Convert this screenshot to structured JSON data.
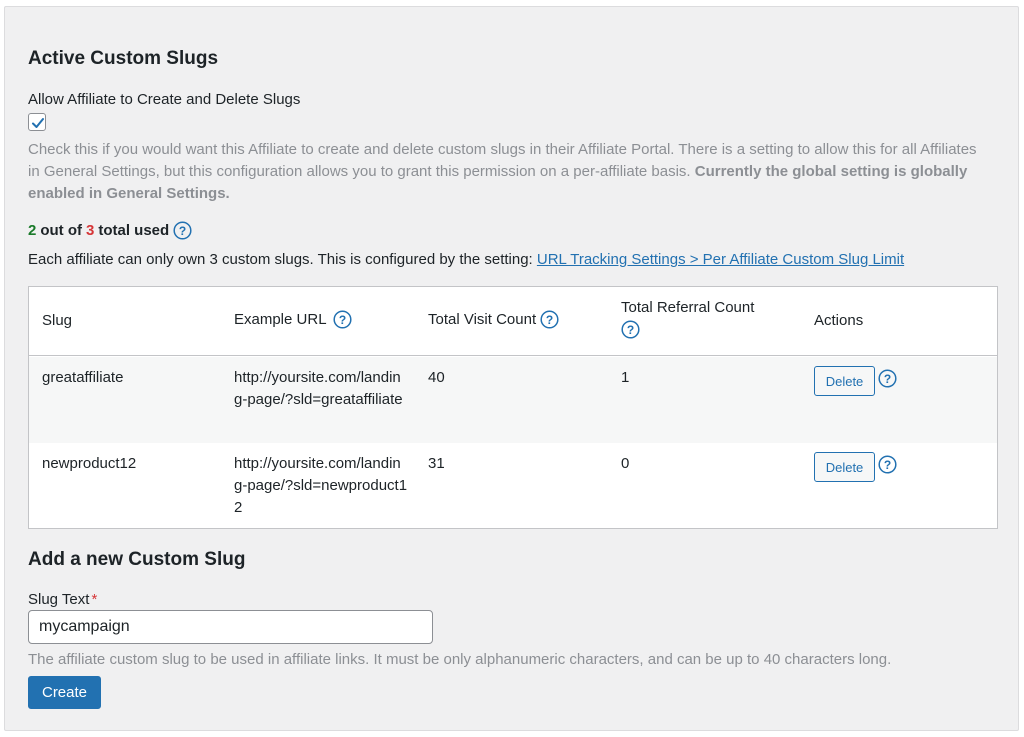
{
  "section": {
    "title": "Active Custom Slugs"
  },
  "permission": {
    "label": "Allow Affiliate to Create and Delete Slugs",
    "checked": true,
    "description": "Check this if you would want this Affiliate to create and delete custom slugs in their Affiliate Portal. There is a setting to allow this for all Affiliates in General Settings, but this configuration allows you to grant this permission on a per-affiliate basis. ",
    "description_bold": "Currently the global setting is globally enabled in General Settings."
  },
  "usage": {
    "used": "2",
    "out_of_text": "out of",
    "total": "3",
    "total_used_text": "total used",
    "used_color": "#1a7a2a",
    "total_color": "#d63638"
  },
  "limit_note": {
    "text": "Each affiliate can only own 3 custom slugs. This is configured by the setting: ",
    "link": "URL Tracking Settings > Per Affiliate Custom Slug Limit"
  },
  "table": {
    "headers": {
      "slug": "Slug",
      "example_url": "Example URL",
      "visit_count": "Total Visit Count",
      "referral_count": "Total Referral Count",
      "actions": "Actions"
    },
    "rows": [
      {
        "slug": "greataffiliate",
        "example_url": "http://yoursite.com/landing-page/?sld=greataffiliate",
        "visits": "40",
        "referrals": "1",
        "delete_label": "Delete"
      },
      {
        "slug": "newproduct12",
        "example_url": "http://yoursite.com/landing-page/?sld=newproduct12",
        "visits": "31",
        "referrals": "0",
        "delete_label": "Delete"
      }
    ]
  },
  "add_form": {
    "title": "Add a new Custom Slug",
    "field_label": "Slug Text",
    "required_mark": "*",
    "value": "mycampaign",
    "hint": "The affiliate custom slug to be used in affiliate links. It must be only alphanumeric characters, and can be up to 40 characters long.",
    "submit_label": "Create"
  },
  "icons": {
    "help": "help-circle-icon",
    "check": "check-icon"
  },
  "colors": {
    "accent": "#2271b1",
    "error": "#d63638",
    "muted": "#8c8f94"
  }
}
